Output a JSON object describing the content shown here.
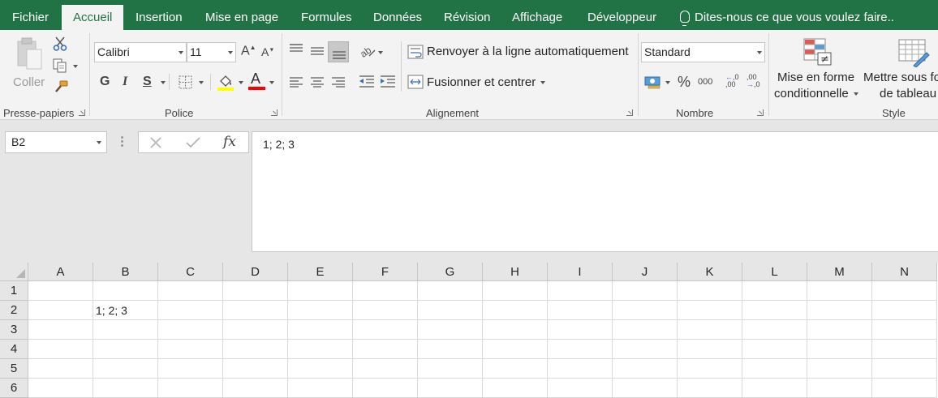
{
  "tabs": [
    "Fichier",
    "Accueil",
    "Insertion",
    "Mise en page",
    "Formules",
    "Données",
    "Révision",
    "Affichage",
    "Développeur"
  ],
  "active_tab": "Accueil",
  "tell_me": "Dites-nous ce que vous voulez faire..",
  "ribbon": {
    "clipboard": {
      "paste_label": "Coller",
      "group_label": "Presse-papiers"
    },
    "font": {
      "font_name": "Calibri",
      "font_size": "11",
      "bold": "G",
      "italic": "I",
      "underline": "S",
      "group_label": "Police"
    },
    "alignment": {
      "wrap_label": "Renvoyer à la ligne automatiquement",
      "merge_label": "Fusionner et centrer",
      "group_label": "Alignement"
    },
    "number": {
      "format": "Standard",
      "percent": "%",
      "thousands": "000",
      "group_label": "Nombre"
    },
    "style": {
      "cond_format_line1": "Mise en forme",
      "cond_format_line2": "conditionnelle",
      "table_line1": "Mettre sous fo",
      "table_line2": "de tableau",
      "group_label": "Style"
    }
  },
  "formula_bar": {
    "name_box": "B2",
    "fx": "fx",
    "content": "1; 2; 3"
  },
  "grid": {
    "columns": [
      "A",
      "B",
      "C",
      "D",
      "E",
      "F",
      "G",
      "H",
      "I",
      "J",
      "K",
      "L",
      "M",
      "N"
    ],
    "rows": [
      "1",
      "2",
      "3",
      "4",
      "5",
      "6"
    ],
    "cells": {
      "B2": "1; 2; 3"
    }
  },
  "colors": {
    "excel_green": "#217346",
    "font_color_red": "#ff0000",
    "highlight_yellow": "#ffff00"
  }
}
